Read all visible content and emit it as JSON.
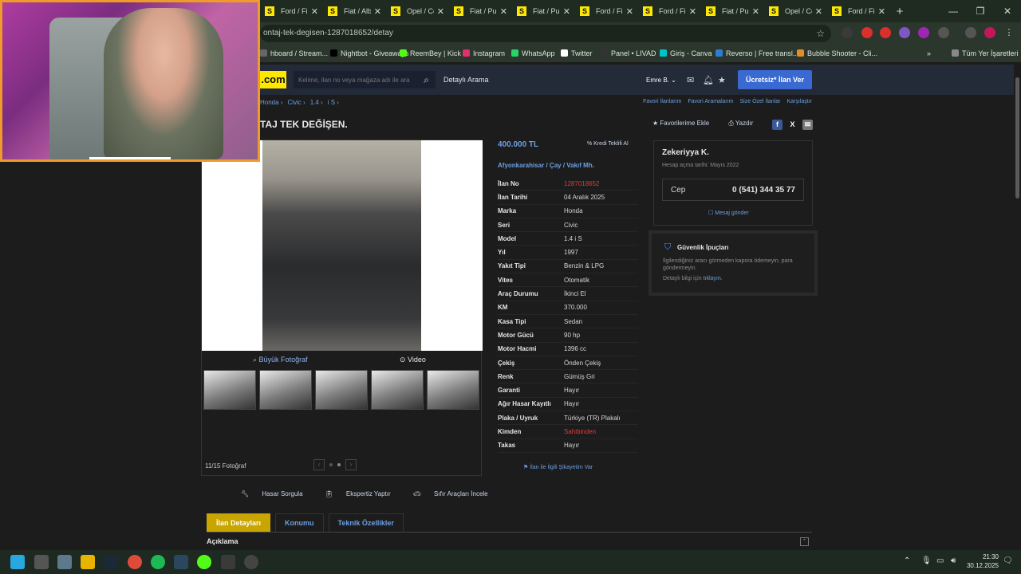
{
  "browser": {
    "tabs": [
      {
        "label": "Ford / Fi"
      },
      {
        "label": "Fiat / Alb"
      },
      {
        "label": "Opel / Co"
      },
      {
        "label": "Fiat / Pu"
      },
      {
        "label": "Fiat / Pu"
      },
      {
        "label": "Ford / Fi"
      },
      {
        "label": "Ford / Fi"
      },
      {
        "label": "Fiat / Pu"
      },
      {
        "label": "Opel / Co"
      },
      {
        "label": "Ford / Fi"
      }
    ],
    "tab_favicon": "S",
    "url": "ontaj-tek-degisen-1287018652/detay",
    "bookmarks": [
      {
        "label": "hboard / Stream..."
      },
      {
        "label": "Nightbot - Giveaways"
      },
      {
        "label": "ReemBey | Kick"
      },
      {
        "label": "Instagram"
      },
      {
        "label": "WhatsApp"
      },
      {
        "label": "Twitter"
      },
      {
        "label": "Panel • LIVAD"
      },
      {
        "label": "Giriş - Canva"
      },
      {
        "label": "Reverso | Free transl..."
      },
      {
        "label": "Bubble Shooter - Cli..."
      },
      {
        "label": "Tüm Yer İşaretleri"
      }
    ]
  },
  "site": {
    "logo": ".com",
    "search_placeholder": "Kelime, ilan no veya mağaza adı ile ara",
    "detailed_search": "Detaylı Arama",
    "user": "Emre B.",
    "cta": "Ücretsiz* İlan Ver"
  },
  "breadcrumb": [
    "Honda ›",
    "Civic ›",
    "1.4 ›",
    "i S ›"
  ],
  "top_links": [
    "Favori İlanlarım",
    "Favori Aramalarım",
    "Size Özel İlanlar",
    "Karşılaştır"
  ],
  "listing": {
    "title": "TAJ TEK DEĞİŞEN.",
    "favorite": "★ Favorilerime Ekle",
    "print": "Yazdır",
    "price": "400.000 TL",
    "credit": "Kredi Teklifi Al",
    "location": "Afyonkarahisar  /  Çay  /  Vakıf Mh.",
    "big_photo": "Büyük Fotoğraf",
    "video": "Video",
    "photo_counter": "11/15 Fotoğraf",
    "complaint": "İlan ile İlgili Şikayetim Var",
    "specs": [
      {
        "key": "İlan No",
        "value": "1287018652",
        "highlight": true
      },
      {
        "key": "İlan Tarihi",
        "value": "04 Aralık 2025"
      },
      {
        "key": "Marka",
        "value": "Honda"
      },
      {
        "key": "Seri",
        "value": "Civic"
      },
      {
        "key": "Model",
        "value": "1.4 i S"
      },
      {
        "key": "Yıl",
        "value": "1997"
      },
      {
        "key": "Yakıt Tipi",
        "value": "Benzin & LPG"
      },
      {
        "key": "Vites",
        "value": "Otomatik"
      },
      {
        "key": "Araç Durumu",
        "value": "İkinci El"
      },
      {
        "key": "KM",
        "value": "370.000"
      },
      {
        "key": "Kasa Tipi",
        "value": "Sedan"
      },
      {
        "key": "Motor Gücü",
        "value": "90 hp"
      },
      {
        "key": "Motor Hacmi",
        "value": "1396 cc"
      },
      {
        "key": "Çekiş",
        "value": "Önden Çekiş"
      },
      {
        "key": "Renk",
        "value": "Gümüş Gri"
      },
      {
        "key": "Garanti",
        "value": "Hayır"
      },
      {
        "key": "Ağır Hasar Kayıtlı",
        "value": "Hayır"
      },
      {
        "key": "Plaka / Uyruk",
        "value": "Türkiye (TR) Plakalı"
      },
      {
        "key": "Kimden",
        "value": "Sahibinden",
        "highlight": true
      },
      {
        "key": "Takas",
        "value": "Hayır"
      }
    ]
  },
  "seller": {
    "name": "Zekeriyya K.",
    "since": "Hesap açma tarihi: Mayıs 2022",
    "phone_label": "Cep",
    "phone": "0 (541) 344 35 77",
    "message": "Mesaj gönder"
  },
  "security": {
    "heading": "Güvenlik İpuçları",
    "body": "İlgilendiğiniz aracı görmeden kapora ödemeyin, para göndermeyin.",
    "more_prefix": "Detaylı bilgi için",
    "more_link": "tıklayın."
  },
  "tools": [
    "Hasar Sorgula",
    "Ekspertiz Yaptır",
    "Sıfır Araçları İncele"
  ],
  "detail_tabs": [
    "İlan Detayları",
    "Konumu",
    "Teknik Özellikler"
  ],
  "description_heading": "Açıklama",
  "clock": {
    "time": "21:30",
    "date": "30.12.2025"
  },
  "colors": {
    "accent": "#ffe800",
    "link": "#6d9fe3",
    "cta": "#3a6ad1",
    "active_tab": "#c8a500",
    "highlight": "#e0393b"
  }
}
